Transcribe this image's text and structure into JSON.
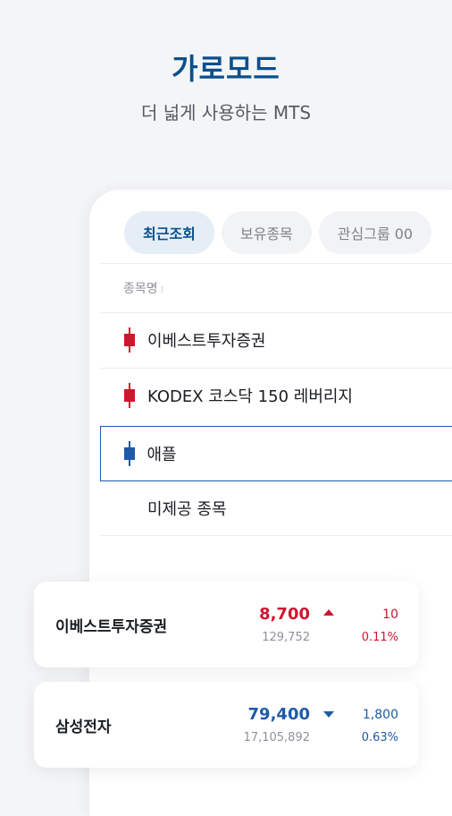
{
  "hero": {
    "title": "가로모드",
    "subtitle": "더 넓게 사용하는 MTS"
  },
  "tabs": [
    {
      "label": "최근조회",
      "active": true
    },
    {
      "label": "보유종목",
      "active": false
    },
    {
      "label": "관심그룹 00",
      "active": false
    }
  ],
  "list": {
    "column_header": "종목명",
    "sort_icon": "sort-updown-icon",
    "items": [
      {
        "label": "이베스트투자증권",
        "candle": "red",
        "selected": false
      },
      {
        "label": "KODEX 코스닥 150 레버리지",
        "candle": "red",
        "selected": false
      },
      {
        "label": "애플",
        "candle": "blue",
        "selected": true
      },
      {
        "label": "미제공 종목",
        "candle": "none",
        "selected": false
      }
    ]
  },
  "cards": [
    {
      "name": "이베스트투자증권",
      "price": "8,700",
      "volume": "129,752",
      "change": "10",
      "rate": "0.11%",
      "direction": "up"
    },
    {
      "name": "삼성전자",
      "price": "79,400",
      "volume": "17,105,892",
      "change": "1,800",
      "rate": "0.63%",
      "direction": "down"
    }
  ],
  "colors": {
    "up": "#d0152e",
    "down": "#1e5aa8",
    "accent": "#0a4f8c"
  }
}
